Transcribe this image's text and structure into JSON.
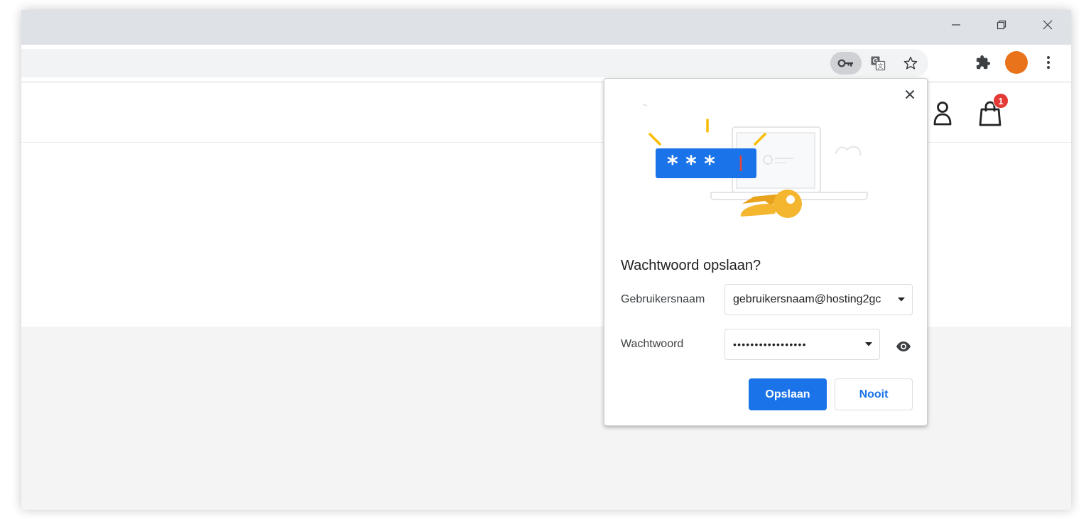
{
  "browser": {
    "window_controls": {
      "minimize_icon": "minimize-icon",
      "restore_icon": "restore-icon",
      "close_icon": "close-icon"
    },
    "toolbar": {
      "password_key_icon": "key-icon",
      "translate_icon": "translate-icon",
      "bookmark_icon": "star-icon",
      "extensions_icon": "puzzle-icon",
      "profile_color": "#e8731b",
      "menu_icon": "kebab-menu-icon"
    }
  },
  "site": {
    "header": {
      "account_icon": "user-icon",
      "cart_icon": "shopping-bag-icon",
      "cart_count": "1"
    }
  },
  "password_popup": {
    "title": "Wachtwoord opslaan?",
    "username_label": "Gebruikersnaam",
    "username_value": "gebruikersnaam@hosting2gc",
    "password_label": "Wachtwoord",
    "password_value": "•••••••••••••••••",
    "save_label": "Opslaan",
    "never_label": "Nooit",
    "illustration_masked": "* * *",
    "colors": {
      "primary": "#1a73e8",
      "key": "#f4b52f",
      "accent": "#fbbc04"
    }
  }
}
